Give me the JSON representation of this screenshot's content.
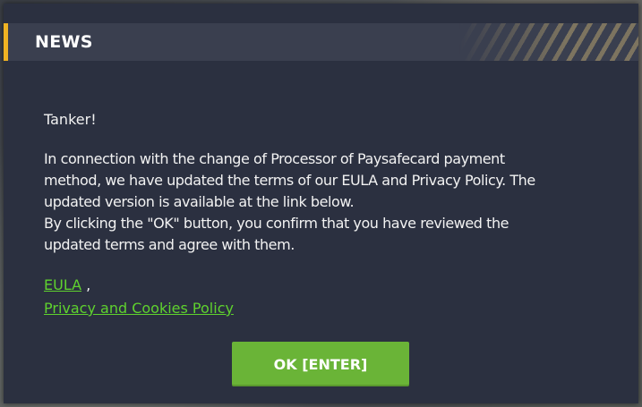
{
  "dialog": {
    "title": "NEWS",
    "greeting": "Tanker!",
    "paragraph_lines": [
      "In connection with the change of Processor of Paysafecard payment",
      "method, we have updated the terms of our EULA and Privacy Policy. The",
      "updated version is available at the link below.",
      "By clicking the \"OK\" button, you confirm that you have reviewed the",
      "updated terms and agree with them."
    ],
    "links": {
      "eula_label": "EULA",
      "separator": " ,",
      "privacy_label": "Privacy and Cookies Policy"
    },
    "ok_button_label": "OK [ENTER]"
  },
  "colors": {
    "dialog_bg": "#2b3040",
    "header_bg": "#3a3f4f",
    "accent": "#f0b323",
    "link": "#5fd22e",
    "button": "#6ab437"
  }
}
